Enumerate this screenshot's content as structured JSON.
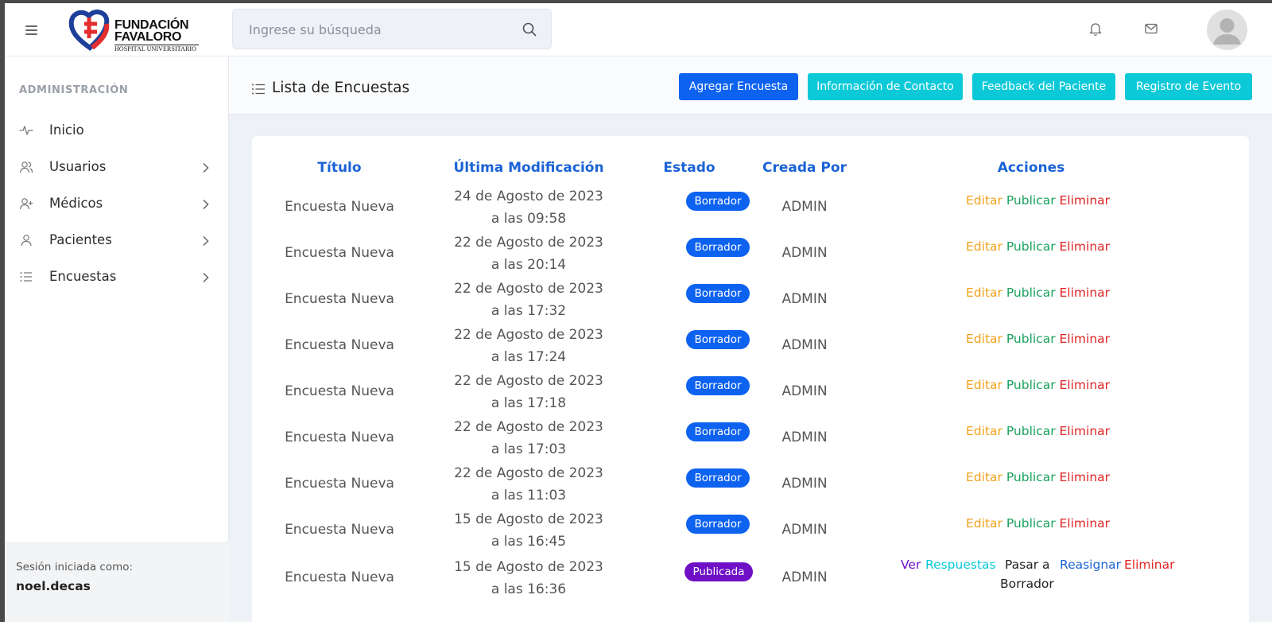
{
  "header": {
    "logo": {
      "line1": "FUNDACIÓN",
      "line2": "FAVALORO",
      "line3": "HOSPITAL UNIVERSITARIO"
    },
    "search_placeholder": "Ingrese su búsqueda"
  },
  "sidebar": {
    "heading": "ADMINISTRACIÓN",
    "items": [
      {
        "label": "Inicio",
        "icon": "activity-icon"
      },
      {
        "label": "Usuarios",
        "icon": "users-icon"
      },
      {
        "label": "Médicos",
        "icon": "user-plus-icon"
      },
      {
        "label": "Pacientes",
        "icon": "user-icon"
      },
      {
        "label": "Encuestas",
        "icon": "list-icon"
      }
    ],
    "session_label": "Sesión iniciada como:",
    "session_user": "noel.decas"
  },
  "page": {
    "title": "Lista de Encuestas",
    "buttons": {
      "add": "Agregar Encuesta",
      "contact": "Información de Contacto",
      "feedback": "Feedback del Paciente",
      "log": "Registro de Evento"
    }
  },
  "table": {
    "headers": {
      "title": "Título",
      "modified": "Última Modificación",
      "status": "Estado",
      "created_by": "Creada Por",
      "actions": "Acciones"
    },
    "rows": [
      {
        "title": "Encuesta Nueva",
        "date": "24 de Agosto de 2023",
        "time": "a las 09:58",
        "status": "Borrador",
        "author": "ADMIN"
      },
      {
        "title": "Encuesta Nueva",
        "date": "22 de Agosto de 2023",
        "time": "a las 20:14",
        "status": "Borrador",
        "author": "ADMIN"
      },
      {
        "title": "Encuesta Nueva",
        "date": "22 de Agosto de 2023",
        "time": "a las 17:32",
        "status": "Borrador",
        "author": "ADMIN"
      },
      {
        "title": "Encuesta Nueva",
        "date": "22 de Agosto de 2023",
        "time": "a las 17:24",
        "status": "Borrador",
        "author": "ADMIN"
      },
      {
        "title": "Encuesta Nueva",
        "date": "22 de Agosto de 2023",
        "time": "a las 17:18",
        "status": "Borrador",
        "author": "ADMIN"
      },
      {
        "title": "Encuesta Nueva",
        "date": "22 de Agosto de 2023",
        "time": "a las 17:03",
        "status": "Borrador",
        "author": "ADMIN"
      },
      {
        "title": "Encuesta Nueva",
        "date": "22 de Agosto de 2023",
        "time": "a las 11:03",
        "status": "Borrador",
        "author": "ADMIN"
      },
      {
        "title": "Encuesta Nueva",
        "date": "15 de Agosto de 2023",
        "time": "a las 16:45",
        "status": "Borrador",
        "author": "ADMIN"
      },
      {
        "title": "Encuesta Nueva",
        "date": "15 de Agosto de 2023",
        "time": "a las 16:36",
        "status": "Publicada",
        "author": "ADMIN"
      }
    ],
    "draft_actions": {
      "edit": "Editar",
      "publish": "Publicar",
      "delete": "Eliminar"
    },
    "published_actions": {
      "view": "Ver",
      "responses": "Respuestas",
      "to_draft_1": "Pasar a",
      "to_draft_2": "Borrador",
      "reassign": "Reasignar",
      "delete": "Eliminar"
    }
  },
  "colors": {
    "primary": "#0d62f0",
    "info": "#0cc9d8",
    "published": "#6f10c6",
    "edit": "#f0a21b",
    "publish": "#19a15c",
    "delete": "#e02424"
  }
}
